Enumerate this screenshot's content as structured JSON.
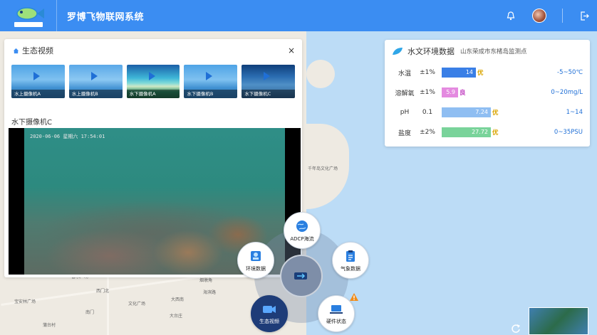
{
  "app": {
    "title": "罗博飞物联网系统",
    "logo_text": "ROBOFISH"
  },
  "header": {
    "icons": [
      "bell-icon",
      "avatar",
      "logout-icon"
    ]
  },
  "video_panel": {
    "title": "生态视频",
    "close_glyph": "×",
    "thumbnails": [
      {
        "label": "水上摄像机A"
      },
      {
        "label": "水上摄像机B"
      },
      {
        "label": "水下摄像机A"
      },
      {
        "label": "水下摄像机B"
      },
      {
        "label": "水下摄像机C"
      }
    ],
    "current_camera": "水下摄像机C",
    "osd": "2020-06-06  星期六  17:54:01"
  },
  "hydro_panel": {
    "title": "水文环境数据",
    "location": "山东荣成市东楮岛监测点",
    "rows": [
      {
        "name": "水温",
        "accuracy": "±1%",
        "value": "14",
        "grade": "优",
        "range": "-5~50℃",
        "color": "#3a7fe6",
        "fill": 0.62,
        "grade_color": "#d9a400"
      },
      {
        "name": "溶解氧",
        "accuracy": "±1%",
        "value": "5.9",
        "grade": "良",
        "range": "0~20mg/L",
        "color": "#e48ae0",
        "fill": 0.3,
        "grade_color": "#c040c0"
      },
      {
        "name": "pH",
        "accuracy": "0.1",
        "value": "7.24",
        "grade": "优",
        "range": "1~14",
        "color": "#8fbef2",
        "fill": 0.88,
        "grade_color": "#d9a400"
      },
      {
        "name": "盐度",
        "accuracy": "±2%",
        "value": "27.72",
        "grade": "优",
        "range": "0~35PSU",
        "color": "#79d39a",
        "fill": 0.88,
        "grade_color": "#d9a400"
      }
    ]
  },
  "radial_menu": {
    "items": [
      {
        "label": "ADCP海流",
        "icon": "globe-icon"
      },
      {
        "label": "环境数据",
        "icon": "environment-icon"
      },
      {
        "label": "气象数据",
        "icon": "clipboard-icon"
      },
      {
        "label": "生态视频",
        "icon": "camera-icon"
      },
      {
        "label": "硬件状态",
        "icon": "laptop-icon"
      }
    ]
  },
  "map": {
    "pois": [
      "千年岛文化广场",
      "香水广场",
      "西门北",
      "宝安林广场",
      "文化广场",
      "南门",
      "大西南",
      "烟墩角",
      "海滨路",
      "大台庄",
      "蒲台村"
    ]
  },
  "colors": {
    "header": "#3b8df2",
    "accent": "#1f6fd6"
  }
}
